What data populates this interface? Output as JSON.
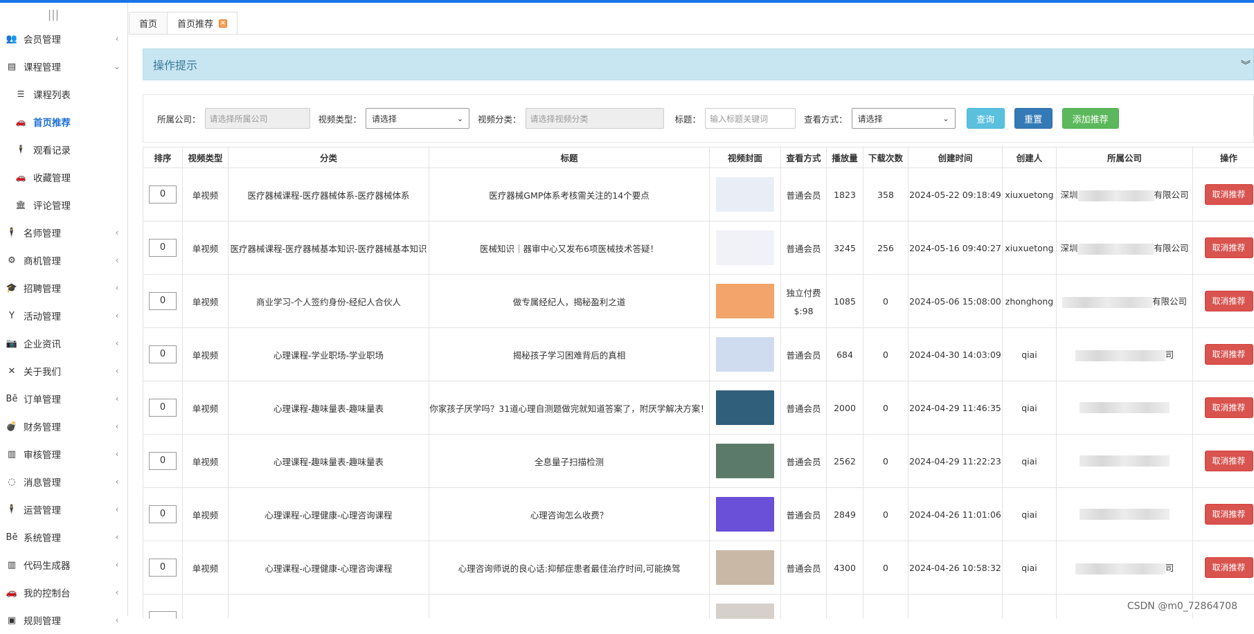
{
  "sidebar": {
    "toggle": "|||",
    "items": [
      {
        "label": "会员管理",
        "icon": "users-icon",
        "glyph": "👥",
        "expanded": false
      },
      {
        "label": "课程管理",
        "icon": "file-icon",
        "glyph": "▤",
        "expanded": true,
        "children": [
          {
            "label": "课程列表",
            "icon": "sliders-icon",
            "glyph": "☰",
            "active": false
          },
          {
            "label": "首页推荐",
            "icon": "car-icon",
            "glyph": "🚗",
            "active": true
          },
          {
            "label": "观看记录",
            "icon": "person-icon",
            "glyph": "🕴",
            "active": false
          },
          {
            "label": "收藏管理",
            "icon": "car-icon",
            "glyph": "🚗",
            "active": false
          },
          {
            "label": "评论管理",
            "icon": "bank-icon",
            "glyph": "🏛",
            "active": false
          }
        ]
      },
      {
        "label": "名师管理",
        "icon": "person-icon",
        "glyph": "🕴",
        "expanded": false
      },
      {
        "label": "商机管理",
        "icon": "bike-icon",
        "glyph": "⚙",
        "expanded": false
      },
      {
        "label": "招聘管理",
        "icon": "graduation-cap-icon",
        "glyph": "🎓",
        "expanded": false
      },
      {
        "label": "活动管理",
        "icon": "y-combinator-icon",
        "glyph": "Y",
        "expanded": false
      },
      {
        "label": "企业资讯",
        "icon": "camera-icon",
        "glyph": "📷",
        "expanded": false
      },
      {
        "label": "关于我们",
        "icon": "crossed-icon",
        "glyph": "✕",
        "expanded": false
      },
      {
        "label": "订单管理",
        "icon": "behance-icon",
        "glyph": "Bē",
        "expanded": false
      },
      {
        "label": "财务管理",
        "icon": "bomb-icon",
        "glyph": "💣",
        "expanded": false
      },
      {
        "label": "审核管理",
        "icon": "building-icon",
        "glyph": "▥",
        "expanded": false
      },
      {
        "label": "消息管理",
        "icon": "circle-notch-icon",
        "glyph": "◌",
        "expanded": false
      },
      {
        "label": "运营管理",
        "icon": "person-icon",
        "glyph": "🕴",
        "expanded": false
      },
      {
        "label": "系统管理",
        "icon": "behance-square-icon",
        "glyph": "Bē",
        "expanded": false
      },
      {
        "label": "代码生成器",
        "icon": "building-icon",
        "glyph": "▥",
        "expanded": false
      },
      {
        "label": "我的控制台",
        "icon": "car-icon",
        "glyph": "🚗",
        "expanded": false
      },
      {
        "label": "规则管理",
        "icon": "car-icon",
        "glyph": "▣",
        "expanded": false
      }
    ]
  },
  "tabs": [
    {
      "label": "首页",
      "active": false
    },
    {
      "label": "首页推荐",
      "active": true,
      "closable": true
    }
  ],
  "hint": {
    "title": "操作提示",
    "toggle": "⌄"
  },
  "filters": {
    "company_label": "所属公司：",
    "company_placeholder": "请选择所属公司",
    "video_type_label": "视频类型：",
    "video_type_value": "请选择",
    "video_category_label": "视频分类：",
    "video_category_placeholder": "请选择视频分类",
    "title_label": "标题：",
    "title_placeholder": "输入标题关键词",
    "view_mode_label": "查看方式：",
    "view_mode_value": "请选择",
    "query_label": "查询",
    "reset_label": "重置",
    "add_label": "添加推荐"
  },
  "table": {
    "headers": [
      "排序",
      "视频类型",
      "分类",
      "标题",
      "视频封面",
      "查看方式",
      "播放量",
      "下载次数",
      "创建时间",
      "创建人",
      "所属公司",
      "操作"
    ],
    "action_label": "取消推荐",
    "rows": [
      {
        "sort": "0",
        "type": "单视频",
        "category": "医疗器械课程-医疗器械体系-医疗器械体系",
        "title": "医疗器械GMP体系考核需关注的14个要点",
        "view": "普通会员",
        "view2": "",
        "plays": "1823",
        "downloads": "358",
        "created": "2024-05-22 09:18:49",
        "creator": "xiuxuetong",
        "company_prefix": "深圳",
        "company_suffix": "有限公司",
        "cover_color": "#e9eef6"
      },
      {
        "sort": "0",
        "type": "单视频",
        "category": "医疗器械课程-医疗器械基本知识-医疗器械基本知识",
        "title": "医械知识｜器审中心又发布6项医械技术答疑！",
        "view": "普通会员",
        "view2": "",
        "plays": "3245",
        "downloads": "256",
        "created": "2024-05-16 09:40:27",
        "creator": "xiuxuetong",
        "company_prefix": "深圳",
        "company_suffix": "有限公司",
        "cover_color": "#f0f2f7"
      },
      {
        "sort": "0",
        "type": "单视频",
        "category": "商业学习-个人签约身份-经纪人合伙人",
        "title": "做专属经纪人，揭秘盈利之道",
        "view": "独立付费",
        "view2": "$:98",
        "plays": "1085",
        "downloads": "0",
        "created": "2024-05-06 15:08:00",
        "creator": "zhonghong",
        "company_prefix": "",
        "company_suffix": "有限公司",
        "cover_color": "#f2a46a"
      },
      {
        "sort": "0",
        "type": "单视频",
        "category": "心理课程-学业职场-学业职场",
        "title": "揭秘孩子学习困难背后的真相",
        "view": "普通会员",
        "view2": "",
        "plays": "684",
        "downloads": "0",
        "created": "2024-04-30 14:03:09",
        "creator": "qiai",
        "company_prefix": "",
        "company_suffix": "司",
        "cover_color": "#cfdcf0"
      },
      {
        "sort": "0",
        "type": "单视频",
        "category": "心理课程-趣味量表-趣味量表",
        "title": "你家孩子厌学吗？31道心理自测题做完就知道答案了，附厌学解决方案！",
        "view": "普通会员",
        "view2": "",
        "plays": "2000",
        "downloads": "0",
        "created": "2024-04-29 11:46:35",
        "creator": "qiai",
        "company_prefix": "",
        "company_suffix": "",
        "cover_color": "#2f5f7a"
      },
      {
        "sort": "0",
        "type": "单视频",
        "category": "心理课程-趣味量表-趣味量表",
        "title": "全息量子扫描检测",
        "view": "普通会员",
        "view2": "",
        "plays": "2562",
        "downloads": "0",
        "created": "2024-04-29 11:22:23",
        "creator": "qiai",
        "company_prefix": "",
        "company_suffix": "",
        "cover_color": "#5c7a6a"
      },
      {
        "sort": "0",
        "type": "单视频",
        "category": "心理课程-心理健康-心理咨询课程",
        "title": "心理咨询怎么收费？",
        "view": "普通会员",
        "view2": "",
        "plays": "2849",
        "downloads": "0",
        "created": "2024-04-26 11:01:06",
        "creator": "qiai",
        "company_prefix": "",
        "company_suffix": "",
        "cover_color": "#6a4fd8"
      },
      {
        "sort": "0",
        "type": "单视频",
        "category": "心理课程-心理健康-心理咨询课程",
        "title": "心理咨询师说的良心话:抑郁症患者最佳治疗时间,可能换驾",
        "view": "普通会员",
        "view2": "",
        "plays": "4300",
        "downloads": "0",
        "created": "2024-04-26 10:58:32",
        "creator": "qiai",
        "company_prefix": "",
        "company_suffix": "司",
        "cover_color": "#c9b8a6"
      },
      {
        "sort": "",
        "type": "",
        "category": "",
        "title": "",
        "view": "",
        "view2": "",
        "plays": "",
        "downloads": "",
        "created": "",
        "creator": "",
        "company_prefix": "",
        "company_suffix": "",
        "cover_color": "#d6d0cc"
      }
    ]
  },
  "watermark": "CSDN @m0_72864708"
}
